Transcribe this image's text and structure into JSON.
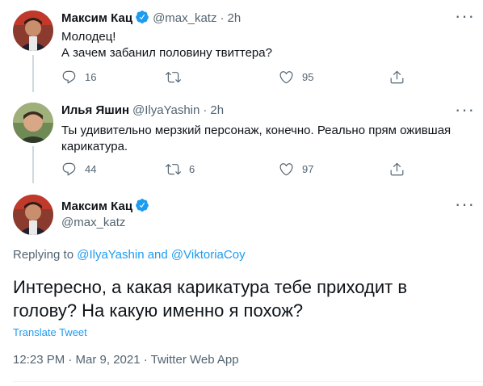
{
  "tweets": [
    {
      "author_name": "Максим Кац",
      "handle": "@max_katz",
      "separator": "·",
      "time": "2h",
      "text_lines": [
        "Молодец!",
        "А зачем забанил половину твиттера?"
      ],
      "reply_count": "16",
      "retweet_count": "",
      "like_count": "95"
    },
    {
      "author_name": "Илья Яшин",
      "handle": "@IlyaYashin",
      "separator": "·",
      "time": "2h",
      "text_lines": [
        "Ты удивительно мерзкий персонаж, конечно. Реально прям ожившая",
        "карикатура."
      ],
      "reply_count": "44",
      "retweet_count": "6",
      "like_count": "97"
    }
  ],
  "main_tweet": {
    "author_name": "Максим Кац",
    "handle": "@max_katz",
    "replying_prefix": "Replying to",
    "replying_user1": "@IlyaYashin",
    "replying_and": "and",
    "replying_user2": "@ViktoriaCoy",
    "text_lines": [
      "Интересно, а какая карикатура тебе приходит в",
      "голову? На какую именно я похож?"
    ],
    "translate_label": "Translate Tweet",
    "timestamp": "12:23 PM · Mar 9, 2021 · Twitter Web App"
  },
  "colors": {
    "accent": "#1d9bf0",
    "muted": "#536471",
    "text": "#0f1419"
  },
  "icons": [
    "reply-icon",
    "retweet-icon",
    "like-icon",
    "share-icon",
    "verified-icon",
    "more-icon"
  ]
}
